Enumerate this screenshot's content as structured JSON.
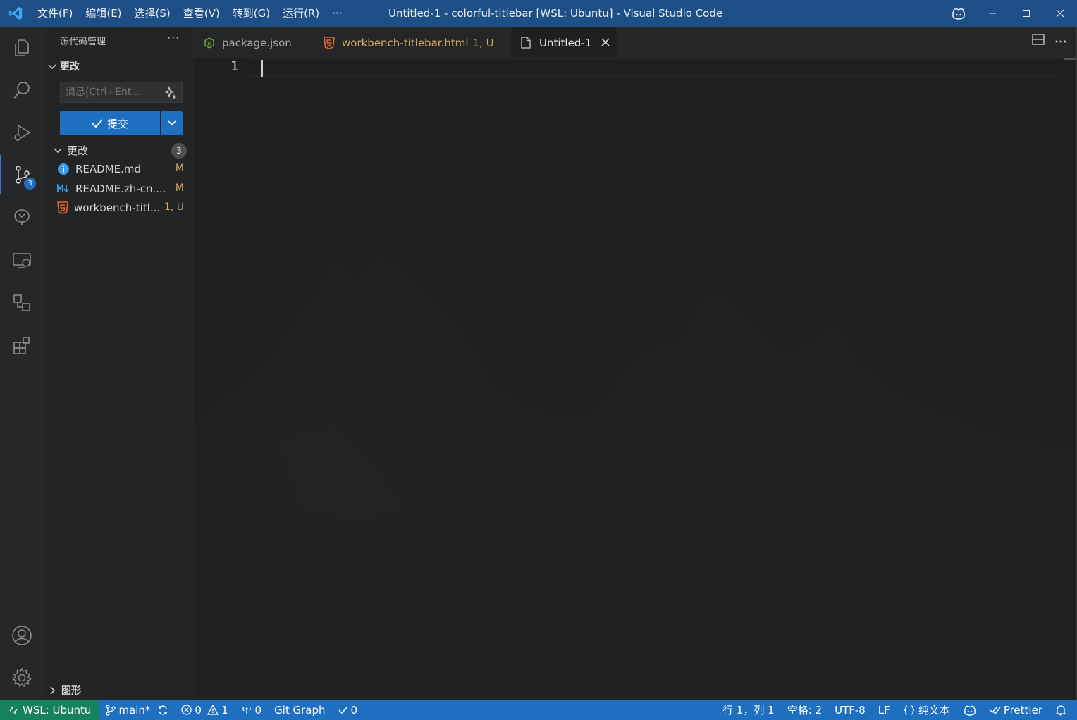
{
  "titlebar": {
    "menus": [
      "文件(F)",
      "编辑(E)",
      "选择(S)",
      "查看(V)",
      "转到(G)",
      "运行(R)",
      "···"
    ],
    "title": "Untitled-1 - colorful-titlebar [WSL: Ubuntu] - Visual Studio Code"
  },
  "sidebar": {
    "header": "源代码管理",
    "more": "···",
    "section_title": "更改",
    "message_placeholder": "消息(Ctrl+Ent...",
    "commit_label": "提交",
    "changes_label": "更改",
    "changes_count": "3",
    "files": [
      {
        "name": "README.md",
        "status": "M",
        "icon": "info-icon"
      },
      {
        "name": "README.zh-cn....",
        "status": "M",
        "icon": "markdown-icon"
      },
      {
        "name": "workbench-titl...",
        "status": "1, U",
        "icon": "html5-icon"
      }
    ],
    "bottom_section": "图形"
  },
  "activity": {
    "scm_badge": "3"
  },
  "tabs": [
    {
      "label": "package.json",
      "extra": "",
      "color": "#a9a9a9",
      "icon": "json-icon"
    },
    {
      "label": "workbench-titlebar.html",
      "extra": "1, U",
      "color": "#d7a95f",
      "icon": "html5-icon"
    },
    {
      "label": "Untitled-1",
      "extra": "",
      "color": "#e8e8e8",
      "icon": "file-icon"
    }
  ],
  "editor": {
    "line_number": "1"
  },
  "statusbar": {
    "remote": "WSL: Ubuntu",
    "branch": "main*",
    "errors": "0",
    "warnings": "1",
    "ports": "0",
    "git_graph": "Git Graph",
    "checks": "0",
    "position": "行 1，列 1",
    "spaces": "空格: 2",
    "encoding": "UTF-8",
    "eol": "LF",
    "language": "纯文本",
    "prettier": "Prettier"
  },
  "colors": {
    "titlebar": "#1d4f86",
    "accent": "#1f6fc0",
    "remote": "#16825d",
    "modified": "#d7a95f"
  }
}
